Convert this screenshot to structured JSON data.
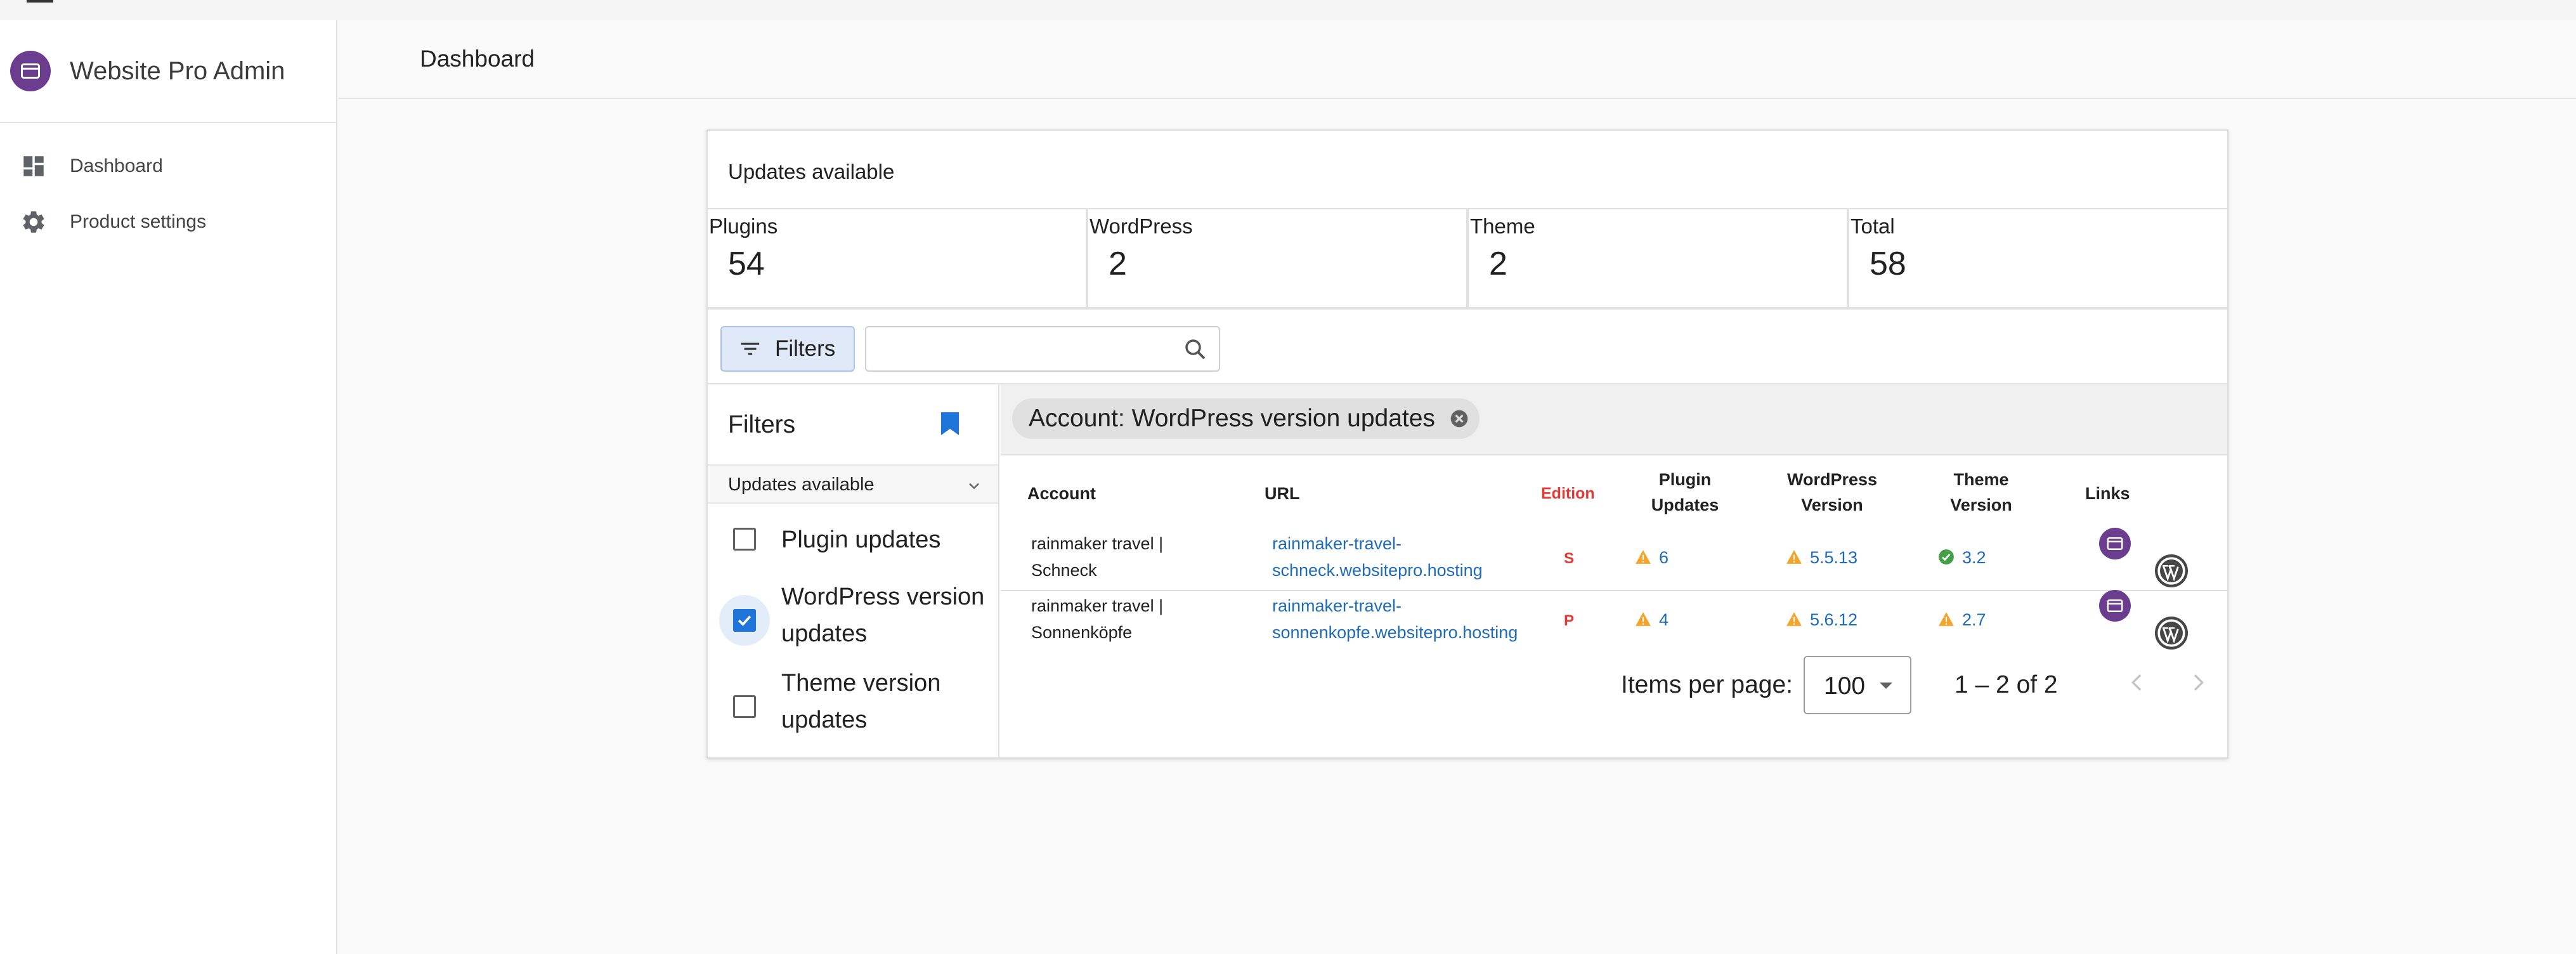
{
  "app": {
    "title": "Website Pro Admin"
  },
  "sidebar": {
    "items": [
      {
        "label": "Dashboard",
        "icon": "dashboard-icon"
      },
      {
        "label": "Product settings",
        "icon": "gear-icon"
      }
    ]
  },
  "header": {
    "title": "Dashboard"
  },
  "card": {
    "title": "Updates available",
    "stats": [
      {
        "label": "Plugins",
        "value": "54"
      },
      {
        "label": "WordPress",
        "value": "2"
      },
      {
        "label": "Theme",
        "value": "2"
      },
      {
        "label": "Total",
        "value": "58"
      }
    ]
  },
  "toolbar": {
    "filters_label": "Filters",
    "search_placeholder": ""
  },
  "filter_panel": {
    "title": "Filters",
    "section": "Updates available",
    "options": [
      {
        "label": "Plugin updates",
        "checked": false
      },
      {
        "label": "WordPress version updates",
        "checked": true
      },
      {
        "label": "Theme version updates",
        "checked": false
      }
    ]
  },
  "chip": {
    "label": "Account: WordPress version updates"
  },
  "table": {
    "headers": {
      "account": "Account",
      "url": "URL",
      "edition": "Edition",
      "plugin_updates": "Plugin Updates",
      "wp_version": "WordPress Version",
      "theme_version": "Theme Version",
      "links": "Links"
    },
    "rows": [
      {
        "account": "rainmaker travel | Schneck",
        "url": "rainmaker-travel-schneck.websitepro.hosting",
        "edition": "S",
        "plugin_updates": "6",
        "wp_version": "5.5.13",
        "theme_version": "3.2",
        "theme_status": "ok"
      },
      {
        "account": "rainmaker travel | Sonnenköpfe",
        "url": "rainmaker-travel-sonnenkopfe.websitepro.hosting",
        "edition": "P",
        "plugin_updates": "4",
        "wp_version": "5.6.12",
        "theme_version": "2.7",
        "theme_status": "warning"
      }
    ]
  },
  "pager": {
    "items_per_page_label": "Items per page:",
    "items_per_page": "100",
    "range": "1 – 2 of 2"
  },
  "colors": {
    "brand": "#6a3d8e",
    "accent": "#1e74d8",
    "link": "#1f6cb6",
    "warning": "#f2a52a",
    "ok": "#43a047",
    "edition": "#e53935"
  }
}
